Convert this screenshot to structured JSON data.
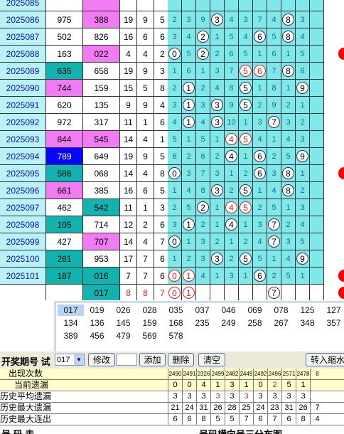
{
  "rows": [
    {
      "period": "2025085",
      "n1": "",
      "n2": "",
      "n1_bg": "white",
      "n2_bg": "pink",
      "d": [
        "",
        "",
        ""
      ],
      "z": [
        "",
        "",
        "",
        "",
        "",
        "",
        "",
        "",
        "",
        "",
        ""
      ],
      "circles": {},
      "red_end": false
    },
    {
      "period": "2025086",
      "n1": "975",
      "n2": "388",
      "n1_bg": "white",
      "n2_bg": "pink",
      "d": [
        "19",
        "9",
        "5"
      ],
      "z": [
        "2",
        "3",
        "9",
        "3",
        "4",
        "3",
        "7",
        "4",
        "8",
        "3",
        ""
      ],
      "circles": {
        "3": "3",
        "8": "8"
      },
      "red_end": false
    },
    {
      "period": "2025087",
      "n1": "502",
      "n2": "826",
      "n1_bg": "white",
      "n2_bg": "white",
      "d": [
        "16",
        "6",
        "6"
      ],
      "z": [
        "3",
        "4",
        "2",
        "1",
        "5",
        "4",
        "6",
        "5",
        "8",
        "4",
        ""
      ],
      "circles": {
        "2": "2",
        "6": "6",
        "8": "8"
      },
      "red_end": false
    },
    {
      "period": "2025088",
      "n1": "163",
      "n2": "022",
      "n1_bg": "white",
      "n2_bg": "pink",
      "d": [
        "4",
        "4",
        "2"
      ],
      "z": [
        "0",
        "5",
        "2",
        "2",
        "6",
        "5",
        "1",
        "6",
        "1",
        "5",
        ""
      ],
      "circles": {
        "0": "0",
        "2": "2"
      },
      "red_end": true
    },
    {
      "period": "2025089",
      "n1": "635",
      "n2": "658",
      "n1_bg": "teal",
      "n2_bg": "white",
      "d": [
        "19",
        "9",
        "3"
      ],
      "z": [
        "1",
        "6",
        "1",
        "3",
        "7",
        "5",
        "6",
        "7",
        "8",
        "6",
        ""
      ],
      "circles": {
        "5": "5",
        "6": "6",
        "8": "8"
      },
      "red_circles": [
        "5",
        "6"
      ],
      "red_end": false
    },
    {
      "period": "2025090",
      "n1": "744",
      "n2": "159",
      "n1_bg": "pink",
      "n2_bg": "white",
      "d": [
        "15",
        "5",
        "8"
      ],
      "z": [
        "2",
        "1",
        "2",
        "4",
        "8",
        "5",
        "1",
        "8",
        "1",
        "9",
        ""
      ],
      "circles": {
        "1": "1",
        "5": "5",
        "9": "9"
      },
      "red_end": false
    },
    {
      "period": "2025091",
      "n1": "620",
      "n2": "135",
      "n1_bg": "white",
      "n2_bg": "white",
      "d": [
        "9",
        "9",
        "4"
      ],
      "z": [
        "3",
        "1",
        "3",
        "3",
        "9",
        "5",
        "2",
        "9",
        "2",
        "1",
        ""
      ],
      "circles": {
        "1": "1",
        "3": "3",
        "5": "5"
      },
      "red_end": false
    },
    {
      "period": "2025092",
      "n1": "972",
      "n2": "317",
      "n1_bg": "white",
      "n2_bg": "white",
      "d": [
        "11",
        "1",
        "6"
      ],
      "z": [
        "4",
        "1",
        "4",
        "3",
        "10",
        "1",
        "3",
        "7",
        "3",
        "2",
        ""
      ],
      "circles": {
        "1": "1",
        "3": "3",
        "7": "7"
      },
      "red_end": false
    },
    {
      "period": "2025093",
      "n1": "844",
      "n2": "545",
      "n1_bg": "pink",
      "n2_bg": "pink",
      "d": [
        "14",
        "4",
        "1"
      ],
      "z": [
        "5",
        "1",
        "5",
        "1",
        "4",
        "5",
        "4",
        "1",
        "4",
        "3",
        ""
      ],
      "circles": {
        "4": "4",
        "5": "5"
      },
      "red_circles": [
        "4",
        "5"
      ],
      "red_end": false
    },
    {
      "period": "2025094",
      "n1": "789",
      "n2": "649",
      "n1_bg": "navy",
      "n2_bg": "white",
      "d": [
        "19",
        "9",
        "5"
      ],
      "z": [
        "6",
        "2",
        "6",
        "2",
        "4",
        "1",
        "6",
        "2",
        "5",
        "9",
        ""
      ],
      "circles": {
        "4": "4",
        "6": "6",
        "9": "9"
      },
      "red_end": false
    },
    {
      "period": "2025095",
      "n1": "586",
      "n2": "068",
      "n1_bg": "teal",
      "n2_bg": "white",
      "d": [
        "14",
        "4",
        "8"
      ],
      "z": [
        "0",
        "3",
        "7",
        "3",
        "1",
        "2",
        "6",
        "3",
        "8",
        "1",
        ""
      ],
      "circles": {
        "0": "0",
        "6": "6",
        "8": "8"
      },
      "red_end": true
    },
    {
      "period": "2025096",
      "n1": "661",
      "n2": "385",
      "n1_bg": "pink",
      "n2_bg": "white",
      "d": [
        "16",
        "6",
        "5"
      ],
      "z": [
        "1",
        "4",
        "8",
        "3",
        "2",
        "5",
        "1",
        "4",
        "8",
        "2",
        ""
      ],
      "circles": {
        "3": "3",
        "5": "5",
        "8": "8"
      },
      "red_end": false
    },
    {
      "period": "2025097",
      "n1": "462",
      "n2": "542",
      "n1_bg": "white",
      "n2_bg": "teal",
      "d": [
        "11",
        "1",
        "3"
      ],
      "z": [
        "2",
        "5",
        "2",
        "1",
        "4",
        "5",
        "2",
        "5",
        "1",
        "3",
        ""
      ],
      "circles": {
        "2": "2",
        "4": "4",
        "5": "5"
      },
      "red_circles": [
        "4",
        "5"
      ],
      "red_end": false
    },
    {
      "period": "2025098",
      "n1": "105",
      "n2": "714",
      "n1_bg": "teal",
      "n2_bg": "white",
      "d": [
        "12",
        "2",
        "6"
      ],
      "z": [
        "3",
        "1",
        "2",
        "1",
        "4",
        "1",
        "3",
        "7",
        "2",
        "4",
        ""
      ],
      "circles": {
        "1": "1",
        "4": "4",
        "7": "7"
      },
      "red_end": false
    },
    {
      "period": "2025099",
      "n1": "427",
      "n2": "707",
      "n1_bg": "white",
      "n2_bg": "pink",
      "d": [
        "14",
        "4",
        "7"
      ],
      "z": [
        "0",
        "1",
        "3",
        "2",
        "1",
        "2",
        "4",
        "7",
        "3",
        "5",
        ""
      ],
      "circles": {
        "0": "0",
        "7": "7"
      },
      "red_end": false
    },
    {
      "period": "2025100",
      "n1": "261",
      "n2": "953",
      "n1_bg": "teal",
      "n2_bg": "white",
      "d": [
        "17",
        "7",
        "6"
      ],
      "z": [
        "1",
        "2",
        "3",
        "3",
        "2",
        "5",
        "5",
        "1",
        "4",
        "9",
        ""
      ],
      "circles": {
        "3": "3",
        "5": "5",
        "9": "9"
      },
      "red_end": false
    },
    {
      "period": "2025101",
      "n1": "187",
      "n2": "016",
      "n1_bg": "teal",
      "n2_bg": "teal",
      "d": [
        "7",
        "7",
        "6"
      ],
      "z": [
        "0",
        "1",
        "4",
        "1",
        "3",
        "1",
        "6",
        "2",
        "5",
        "1",
        ""
      ],
      "circles": {
        "0": "0",
        "1": "1",
        "6": "6"
      },
      "red_circles": [
        "0",
        "1"
      ],
      "red_end": true
    },
    {
      "period": "",
      "n1": "",
      "n2": "017",
      "n1_bg": "white",
      "n2_bg": "teal",
      "d": [
        "8",
        "8",
        "7"
      ],
      "z": [
        "0",
        "1",
        "",
        "",
        "",
        "",
        "",
        "7",
        "",
        "",
        ""
      ],
      "circles": {
        "0": "0",
        "1": "1",
        "7": "7"
      },
      "red_circles": [
        "0",
        "1"
      ],
      "red_end": true,
      "pred": true
    }
  ],
  "popup": {
    "options": [
      "017",
      "019",
      "026",
      "028",
      "035",
      "037",
      "046",
      "069",
      "078",
      "125",
      "127",
      "134",
      "136",
      "145",
      "159",
      "168",
      "235",
      "249",
      "258",
      "267",
      "348",
      "357",
      "389",
      "456",
      "479",
      "569",
      "578"
    ],
    "selected": "017"
  },
  "toolbar": {
    "label": "开奖期号 试",
    "select_value": "017",
    "modify": "修改",
    "add": "添加",
    "delete": "删除",
    "clear": "清空",
    "import": "转入缩水"
  },
  "stats": [
    {
      "label": "出现次数",
      "values": [
        "2490",
        "2491",
        "2326",
        "2499",
        "2482",
        "2449",
        "2492",
        "2496",
        "2571",
        "2478",
        "8"
      ]
    },
    {
      "label": "当前遗漏",
      "values": [
        "0",
        "0",
        "4",
        "1",
        "3",
        "1",
        "0",
        "2",
        "5",
        "1",
        ""
      ],
      "red_idx": [
        7
      ]
    },
    {
      "label": "历史平均遗漏",
      "values": [
        "3",
        "3",
        "3",
        "3",
        "3",
        "3",
        "3",
        "3",
        "3",
        "3",
        ""
      ],
      "red_idx": [
        3,
        5
      ]
    },
    {
      "label": "历史最大遗漏",
      "values": [
        "21",
        "24",
        "31",
        "26",
        "28",
        "25",
        "24",
        "23",
        "31",
        "26",
        "7"
      ]
    },
    {
      "label": "历史最大连出",
      "values": [
        "6",
        "6",
        "8",
        "5",
        "5",
        "7",
        "6",
        "7",
        "6",
        "8",
        "4"
      ]
    }
  ],
  "footer": {
    "left": "号 码 走",
    "center": "号码横向号三分布图"
  },
  "colors": {
    "period_bg": "#b9f2f6",
    "zone_bg": "#7fe8ea",
    "pink": "#f27af2",
    "teal": "#12b3ae",
    "navy": "#0505ff"
  }
}
